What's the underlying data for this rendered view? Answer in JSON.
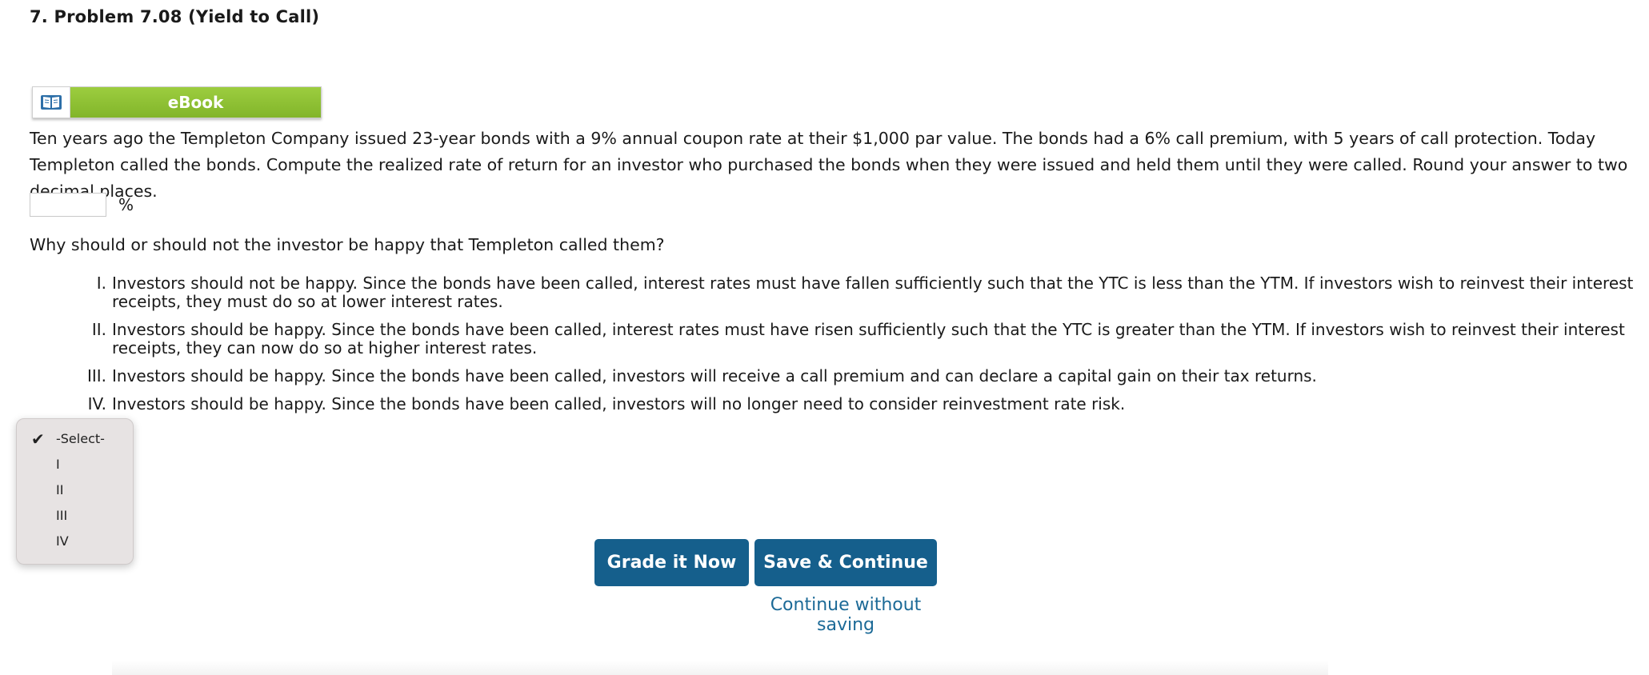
{
  "problem": {
    "title": "7.  Problem 7.08 (Yield to Call)"
  },
  "ebook": {
    "label": "eBook",
    "icon": "book-icon"
  },
  "question": {
    "text": "Ten years ago the Templeton Company issued 23-year bonds with a 9% annual coupon rate at their $1,000 par value. The bonds had a 6% call premium, with 5 years of call protection. Today Templeton called the bonds. Compute the realized rate of return for an investor who purchased the bonds when they were issued and held them until they were called. Round your answer to two decimal places."
  },
  "answer": {
    "value": "",
    "unit": "%"
  },
  "why": {
    "prompt": "Why should or should not the investor be happy that Templeton called them?"
  },
  "options": [
    {
      "num": "I.",
      "text": "Investors should not be happy. Since the bonds have been called, interest rates must have fallen sufficiently such that the YTC is less than the YTM. If investors wish to reinvest their interest receipts, they must do so at lower interest rates."
    },
    {
      "num": "II.",
      "text": "Investors should be happy. Since the bonds have been called, interest rates must have risen sufficiently such that the YTC is greater than the YTM. If investors wish to reinvest their interest receipts, they can now do so at higher interest rates."
    },
    {
      "num": "III.",
      "text": "Investors should be happy. Since the bonds have been called, investors will receive a call premium and can declare a capital gain on their tax returns."
    },
    {
      "num": "IV.",
      "text": "Investors should be happy. Since the bonds have been called, investors will no longer need to consider reinvestment rate risk."
    }
  ],
  "dropdown": {
    "selected": "-Select-",
    "check_icon": "checkmark-icon",
    "items": [
      "-Select-",
      "I",
      "II",
      "III",
      "IV"
    ]
  },
  "buttons": {
    "grade": "Grade it Now",
    "save": "Save & Continue",
    "continue_link": "Continue without saving"
  },
  "colors": {
    "button_bg": "#155f8c",
    "link": "#1c6a97",
    "ebook_green": "#8dc034"
  }
}
